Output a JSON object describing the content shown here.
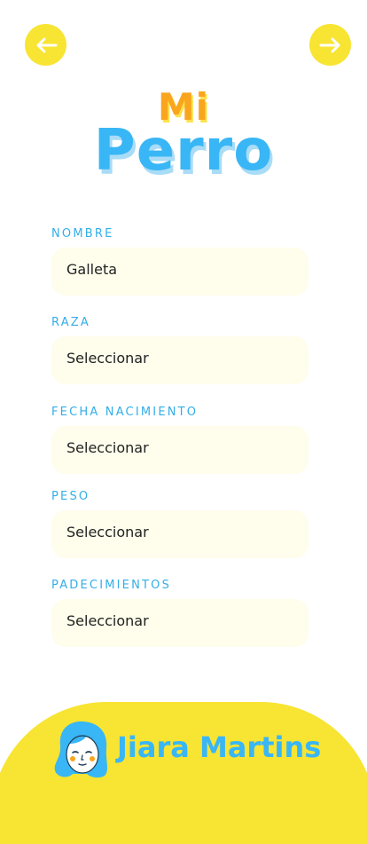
{
  "header": {
    "title_small": "Mi",
    "title_large": "Perro"
  },
  "form": {
    "fields": [
      {
        "label": "NOMBRE",
        "value": "Galleta"
      },
      {
        "label": "RAZA",
        "value": "Seleccionar"
      },
      {
        "label": "FECHA NACIMIENTO",
        "value": "Seleccionar"
      },
      {
        "label": "PESO",
        "value": "Seleccionar"
      },
      {
        "label": "PADECIMIENTOS",
        "value": "Seleccionar"
      }
    ]
  },
  "footer": {
    "user_name": "Jiara Martins"
  },
  "icons": {
    "back": "arrow-left-icon",
    "next": "arrow-right-icon",
    "avatar": "avatar-illustration"
  },
  "colors": {
    "accent_yellow": "#f8e432",
    "accent_blue": "#39b6f5",
    "accent_orange": "#f9a51e",
    "field_bg": "#fffdeb"
  }
}
